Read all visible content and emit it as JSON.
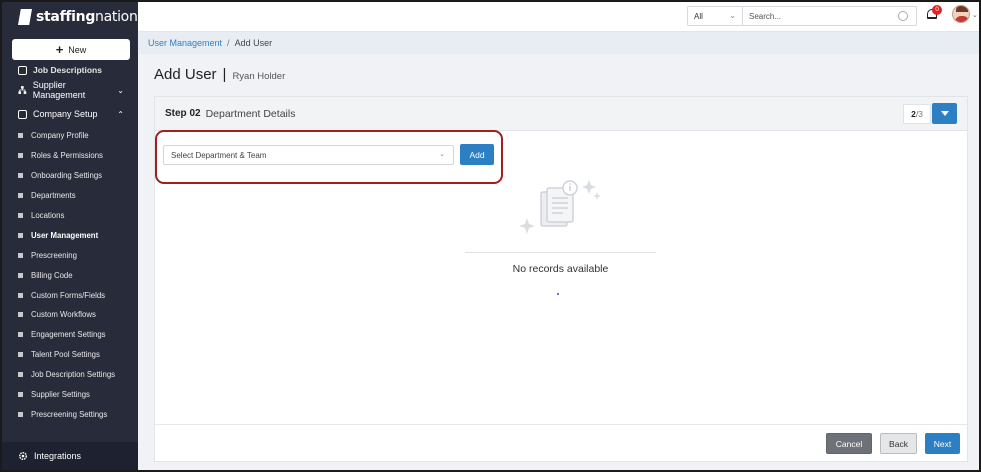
{
  "app": {
    "logo_bold": "staffing",
    "logo_thin": "nation"
  },
  "sidebar": {
    "new_label": "New",
    "top_partial": "Job Descriptions",
    "supplier_label": "Supplier Management",
    "company_setup_label": "Company Setup",
    "items": [
      {
        "label": "Company Profile"
      },
      {
        "label": "Roles & Permissions"
      },
      {
        "label": "Onboarding Settings"
      },
      {
        "label": "Departments"
      },
      {
        "label": "Locations"
      },
      {
        "label": "User Management",
        "active": true
      },
      {
        "label": "Prescreening"
      },
      {
        "label": "Billing Code"
      },
      {
        "label": "Custom Forms/Fields"
      },
      {
        "label": "Custom Workflows"
      },
      {
        "label": "Engagement Settings"
      },
      {
        "label": "Talent Pool Settings"
      },
      {
        "label": "Job Description Settings"
      },
      {
        "label": "Supplier Settings"
      },
      {
        "label": "Prescreening Settings"
      }
    ],
    "integrations_label": "Integrations"
  },
  "header": {
    "scope_value": "All",
    "search_placeholder": "Search...",
    "notification_count": "0"
  },
  "breadcrumb": {
    "parent": "User Management",
    "separator": "/",
    "current": "Add User"
  },
  "page": {
    "title": "Add User",
    "title_separator": "|",
    "subtitle": "Ryan Holder"
  },
  "step": {
    "number_label": "Step 02",
    "title": "Department Details",
    "current": "2",
    "total": "/3"
  },
  "form": {
    "department_placeholder": "Select Department & Team",
    "add_label": "Add"
  },
  "empty": {
    "message": "No records available"
  },
  "footer": {
    "cancel_label": "Cancel",
    "back_label": "Back",
    "next_label": "Next"
  },
  "colors": {
    "sidebar_bg": "#272b3a",
    "primary": "#2d7fc4",
    "highlight": "#a02020",
    "badge": "#e02424"
  }
}
